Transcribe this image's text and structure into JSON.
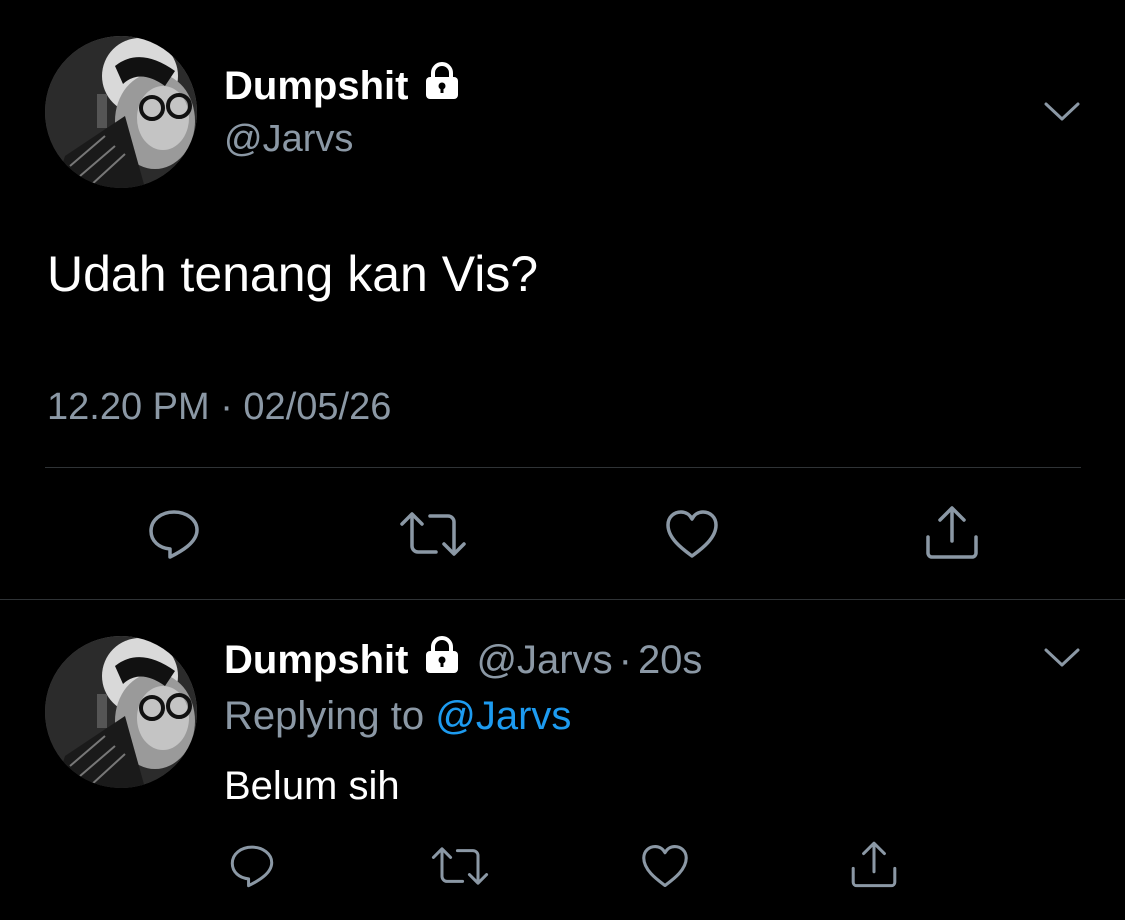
{
  "main_tweet": {
    "display_name": "Dumpshit",
    "handle": "@Jarvs",
    "text": "Udah tenang kan Vis?",
    "timestamp": "12.20 PM · 02/05/26",
    "icons": {
      "lock": "lock-icon",
      "menu": "chevron-down-icon",
      "reply": "reply-icon",
      "retweet": "retweet-icon",
      "like": "heart-icon",
      "share": "share-icon"
    }
  },
  "reply_tweet": {
    "display_name": "Dumpshit",
    "handle": "@Jarvs",
    "separator": "·",
    "time": "20s",
    "replying_prefix": "Replying to",
    "replying_to": "@Jarvs",
    "text": "Belum sih"
  },
  "colors": {
    "background": "#000000",
    "text": "#ffffff",
    "secondary_text": "#8b98a5",
    "accent": "#1d9bf0",
    "divider": "#2f3336"
  }
}
